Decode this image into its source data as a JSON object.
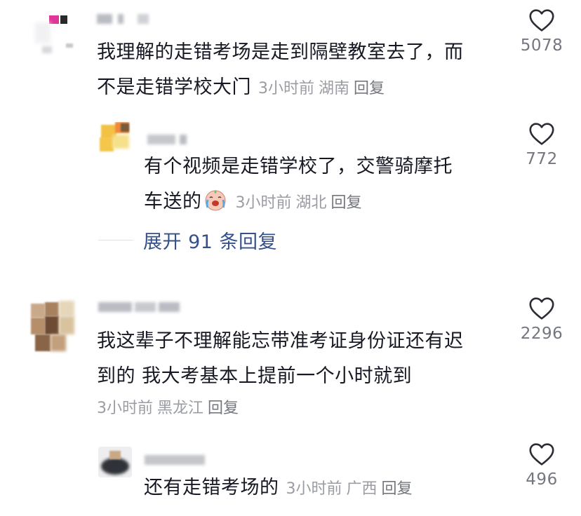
{
  "comments": [
    {
      "text_line1": "我理解的走错考场是走到隔壁教室去了，而",
      "text_line2": "不是走错学校大门",
      "time": "3小时前",
      "location": "湖南",
      "reply": "回复",
      "likes": "5078"
    },
    {
      "text_line1": "有个视频是走错学校了，交警骑摩托",
      "text_line2": "车送的",
      "emoji": "crying-face-emoji",
      "time": "3小时前",
      "location": "湖北",
      "reply": "回复",
      "likes": "772"
    },
    {
      "text_line1": "我这辈子不理解能忘带准考证身份证还有迟",
      "text_line2": "到的 我大考基本上提前一个小时就到",
      "time": "3小时前",
      "location": "黑龙江",
      "reply": "回复",
      "likes": "2296"
    },
    {
      "text_line1": "还有走错考场的",
      "time": "3小时前",
      "location": "广西",
      "reply": "回复",
      "likes": "496"
    }
  ],
  "expand_replies": "展开 91 条回复",
  "icons": {
    "like": "heart-outline-icon"
  },
  "colors": {
    "text": "#161823",
    "meta": "#9a9ca3",
    "link": "#35508a",
    "icon": "#2b2d36"
  }
}
